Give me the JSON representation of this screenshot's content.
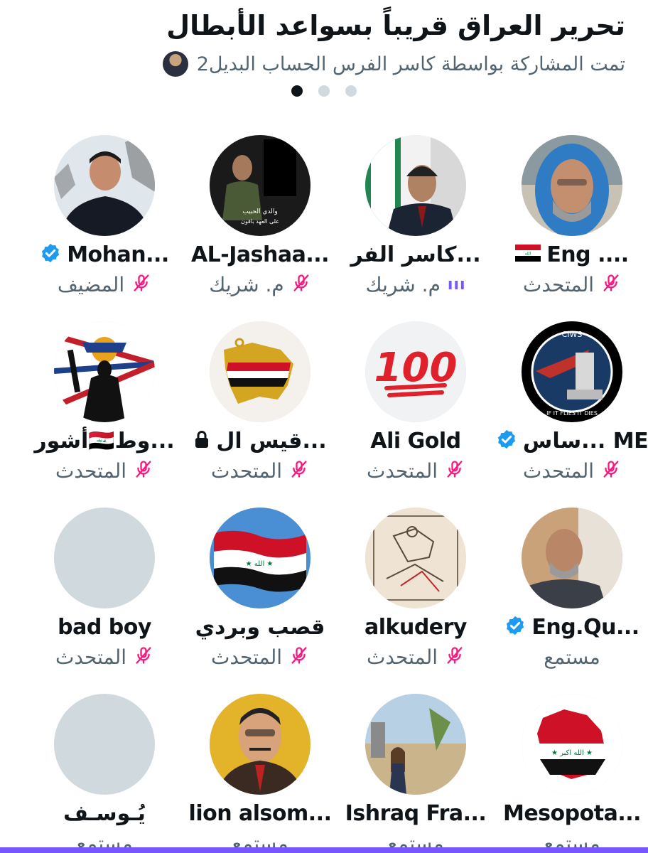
{
  "space": {
    "title": "تحرير العراق قريباً بسواعد الأبطال",
    "shared_by": "تمت المشاركة بواسطة كاسر الفرس الحساب البديل2",
    "pages": 3,
    "active_page": 1
  },
  "participants": [
    {
      "name": "Eng ....",
      "role": "المتحدث",
      "muted": true,
      "flag": true,
      "avatar": "photo-man-hoodie"
    },
    {
      "name": "كاسر الفر...",
      "role": "م. شريك",
      "muted": false,
      "speaking": "ııı",
      "avatar": "photo-flag-portrait"
    },
    {
      "name": "AL-Jashaa...",
      "role": "م. شريك",
      "muted": true,
      "avatar": "photo-uniform",
      "avatar_text": [
        "والدي الحبيب",
        "على العهد باقون"
      ]
    },
    {
      "name": "Mohan...",
      "role": "المضيف",
      "muted": true,
      "verified": true,
      "avatar": "photo-man-snow"
    },
    {
      "name": "ساس... ME",
      "role": "المتحدث",
      "muted": true,
      "verified": true,
      "avatar": "logo-ciws",
      "avatar_text": [
        "CIWS",
        "IF IT FLIES IT DIES"
      ]
    },
    {
      "name": "Ali Gold",
      "role": "المتحدث",
      "muted": true,
      "avatar": "emoji-100",
      "avatar_text": [
        "100"
      ]
    },
    {
      "name": "قيس ال...",
      "role": "المتحدث",
      "muted": true,
      "locked": true,
      "avatar": "gold-map"
    },
    {
      "name": "أشور🇮🇶وط...",
      "role": "المتحدث",
      "muted": true,
      "avatar": "assyrian-flag"
    },
    {
      "name": "Eng.Qu...",
      "role": "مستمع",
      "muted": false,
      "verified": true,
      "avatar": "photo-older-man"
    },
    {
      "name": "alkudery",
      "role": "المتحدث",
      "muted": true,
      "avatar": "sketch"
    },
    {
      "name": "قصب وبردي",
      "role": "المتحدث",
      "muted": true,
      "avatar": "iraq-flag-wave"
    },
    {
      "name": "bad boy",
      "role": "المتحدث",
      "muted": true,
      "avatar": "blank"
    },
    {
      "name": "Mesopota...",
      "role": "مستمع",
      "muted": false,
      "avatar": "iraq-map-flag"
    },
    {
      "name": "Ishraq Fra...",
      "role": "مستمع",
      "muted": false,
      "avatar": "photo-woman-street"
    },
    {
      "name": "lion alsom...",
      "role": "مستمع",
      "muted": false,
      "avatar": "painting-man"
    },
    {
      "name": "يُـوسـف",
      "role": "مستمع",
      "muted": false,
      "avatar": "blank"
    }
  ],
  "colors": {
    "text": "#0f1419",
    "secondary": "#536471",
    "mic_off": "#f91880",
    "verified": "#1d9bf0",
    "speaking": "#7856ff",
    "placeholder": "#cfd9de",
    "accent_bar": "#7856ff"
  },
  "icons": {
    "muted": "mic-off-icon",
    "verified": "verified-badge-icon",
    "locked": "lock-icon",
    "flag": "iraq-flag-icon"
  }
}
